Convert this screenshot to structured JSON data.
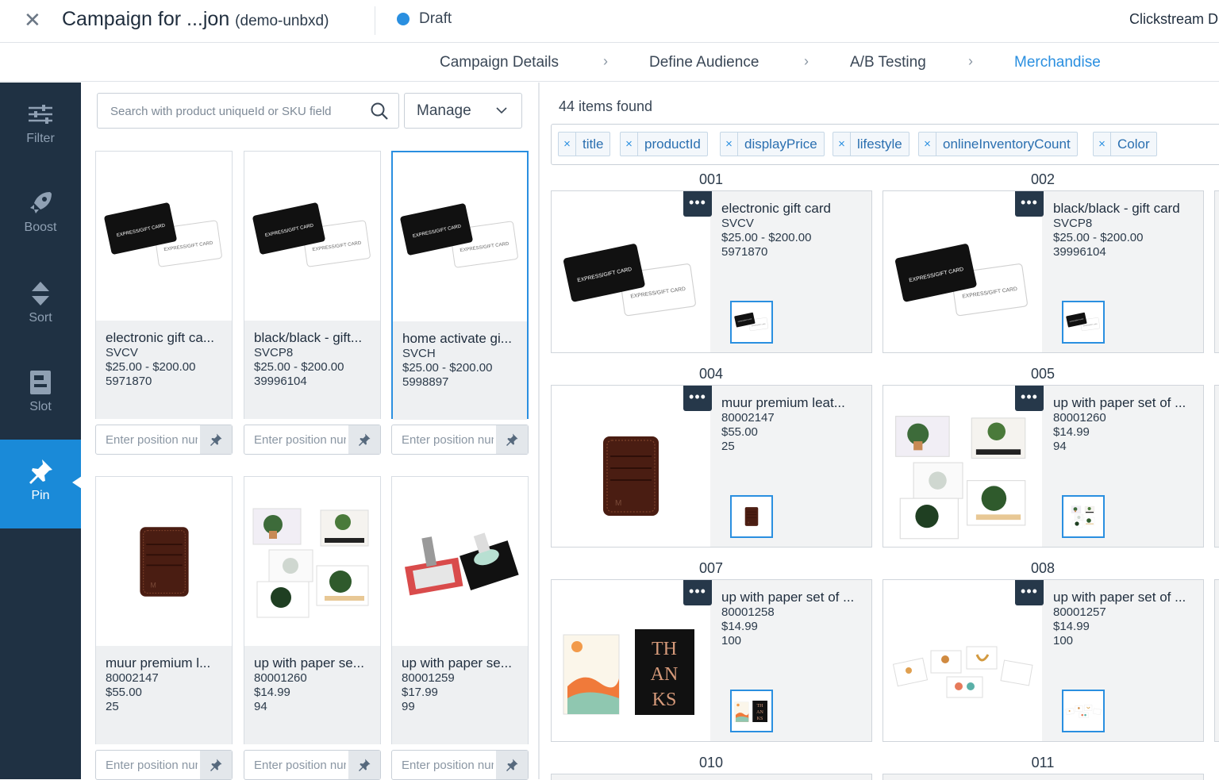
{
  "header": {
    "title": "Campaign for ...jon",
    "site": "(demo-unbxd)",
    "status": "Draft",
    "status_color": "#2a8fe0",
    "right_label": "Clickstream D"
  },
  "steps": [
    "Campaign Details",
    "Define Audience",
    "A/B Testing",
    "Merchandise"
  ],
  "active_step": "Merchandise",
  "nav": [
    {
      "label": "Filter",
      "icon": "filter-icon"
    },
    {
      "label": "Boost",
      "icon": "rocket-icon"
    },
    {
      "label": "Sort",
      "icon": "sort-icon"
    },
    {
      "label": "Slot",
      "icon": "slot-icon"
    },
    {
      "label": "Pin",
      "icon": "pin-icon",
      "active": true
    }
  ],
  "search": {
    "placeholder": "Search with product uniqueId or SKU field"
  },
  "manage": {
    "label": "Manage"
  },
  "position_placeholder": "Enter position number",
  "products": [
    {
      "name": "electronic gift ca...",
      "sku": "SVCV",
      "price": "$25.00 - $200.00",
      "id": "5971870",
      "image": "giftcard"
    },
    {
      "name": "black/black - gift...",
      "sku": "SVCP8",
      "price": "$25.00 - $200.00",
      "id": "39996104",
      "image": "giftcard"
    },
    {
      "name": "home activate gi...",
      "sku": "SVCH",
      "price": "$25.00 - $200.00",
      "id": "5998897",
      "image": "giftcard",
      "selected": true
    },
    {
      "name": "muur premium l...",
      "sku": "80002147",
      "price": "$55.00",
      "id": "25",
      "image": "wallet"
    },
    {
      "name": "up with paper se...",
      "sku": "80001260",
      "price": "$14.99",
      "id": "94",
      "image": "cards-plants"
    },
    {
      "name": "up with paper se...",
      "sku": "80001259",
      "price": "$17.99",
      "id": "99",
      "image": "popup"
    }
  ],
  "results": {
    "count_label": "44 items found",
    "fields": [
      "title",
      "productId",
      "displayPrice",
      "lifestyle",
      "onlineInventoryCount",
      "Color"
    ],
    "items": [
      {
        "pos": "001",
        "name": "electronic gift card",
        "l1": "SVCV",
        "l2": "$25.00 - $200.00",
        "l3": "5971870",
        "image": "giftcard"
      },
      {
        "pos": "002",
        "name": "black/black - gift card",
        "l1": "SVCP8",
        "l2": "$25.00 - $200.00",
        "l3": "39996104",
        "image": "giftcard"
      },
      {
        "pos": "004",
        "name": "muur premium leat...",
        "l1": "80002147",
        "l2": "$55.00",
        "l3": "25",
        "image": "wallet"
      },
      {
        "pos": "005",
        "name": "up with paper set of ...",
        "l1": "80001260",
        "l2": "$14.99",
        "l3": "94",
        "image": "cards-plants"
      },
      {
        "pos": "007",
        "name": "up with paper set of ...",
        "l1": "80001258",
        "l2": "$14.99",
        "l3": "100",
        "image": "thanks"
      },
      {
        "pos": "008",
        "name": "up with paper set of ...",
        "l1": "80001257",
        "l2": "$14.99",
        "l3": "100",
        "image": "small-cards"
      }
    ],
    "next_positions": [
      "010",
      "011"
    ],
    "more_label": "•••"
  }
}
